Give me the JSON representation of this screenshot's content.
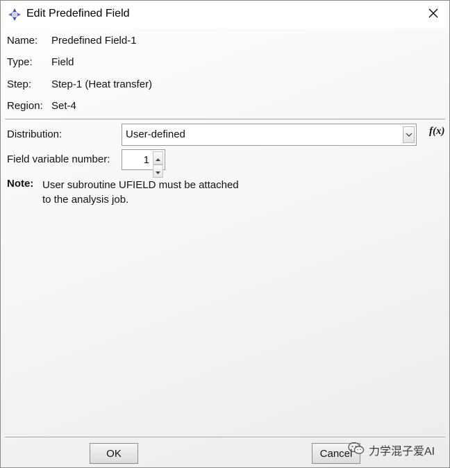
{
  "window": {
    "title": "Edit Predefined Field",
    "icon": "abaqus-compass-icon"
  },
  "info": {
    "name_label": "Name:",
    "name_value": "Predefined Field-1",
    "type_label": "Type:",
    "type_value": "Field",
    "step_label": "Step:",
    "step_value": "Step-1 (Heat transfer)",
    "region_label": "Region:",
    "region_value": "Set-4"
  },
  "distribution": {
    "label": "Distribution:",
    "selected": "User-defined",
    "fx_label": "f(x)"
  },
  "field_variable": {
    "label": "Field variable number:",
    "value": "1"
  },
  "note": {
    "label": "Note:",
    "line1": "User subroutine UFIELD must be attached",
    "line2": "to the analysis job."
  },
  "buttons": {
    "ok": "OK",
    "cancel": "Cancel"
  },
  "watermark": {
    "text": "力学混子爱AI",
    "icon": "wechat-icon"
  }
}
